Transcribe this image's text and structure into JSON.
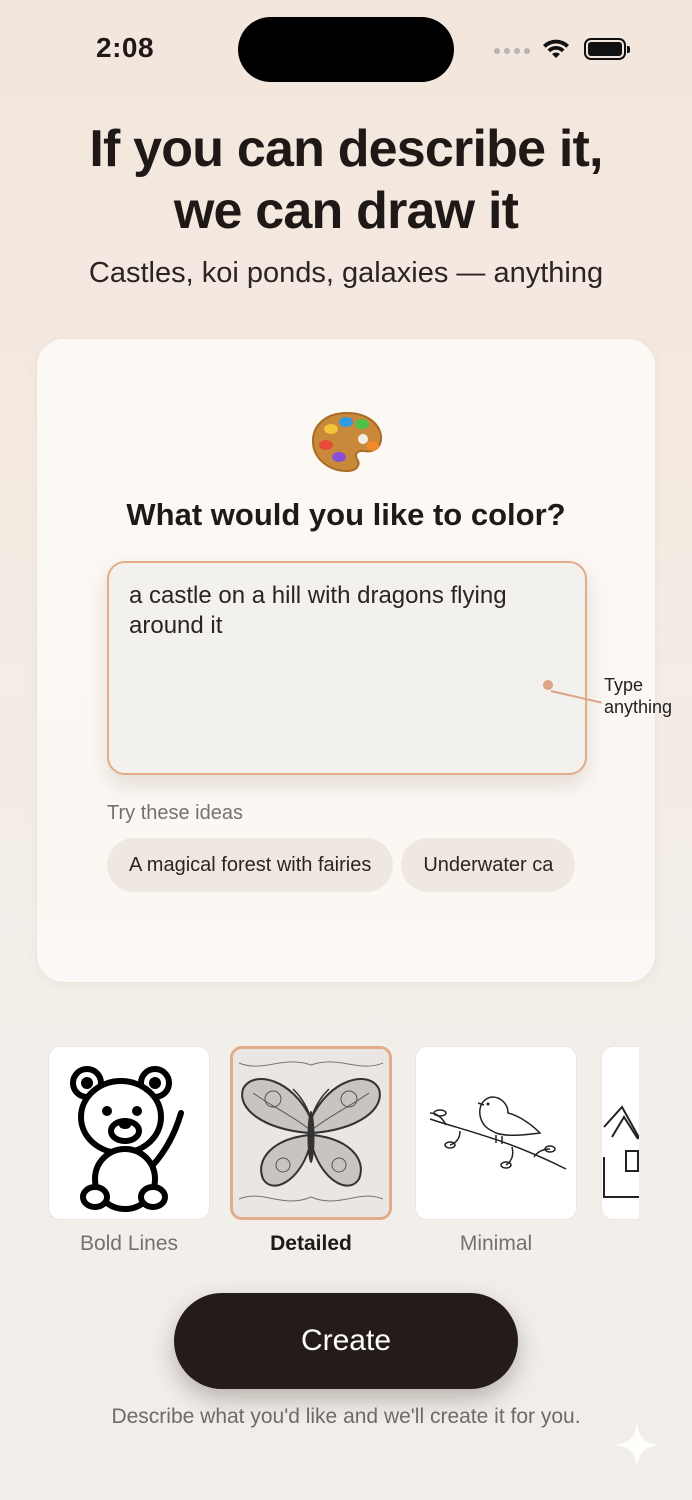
{
  "status_bar": {
    "time": "2:08"
  },
  "hero": {
    "title_line1": "If you can describe it,",
    "title_line2": "we can draw it",
    "subtitle": "Castles, koi ponds, galaxies — anything"
  },
  "card": {
    "title": "What would you like to color?",
    "prompt_value": "a castle on a hill with dragons flying around it",
    "callout": "Type anything",
    "ideas_label": "Try these ideas",
    "ideas": [
      "A magical forest with fairies",
      "Underwater ca"
    ]
  },
  "styles": [
    {
      "label": "Bold Lines",
      "icon": "teddy-bear",
      "selected": false
    },
    {
      "label": "Detailed",
      "icon": "butterfly",
      "selected": true
    },
    {
      "label": "Minimal",
      "icon": "bird-on-branch",
      "selected": false
    },
    {
      "label": "",
      "icon": "house",
      "selected": false
    }
  ],
  "create_button": "Create",
  "footer_note": "Describe what you'd like and we'll create it for you.",
  "colors": {
    "accent": "#e2ab8a",
    "button_bg": "#251c1a",
    "background": "#f3e6dc"
  }
}
